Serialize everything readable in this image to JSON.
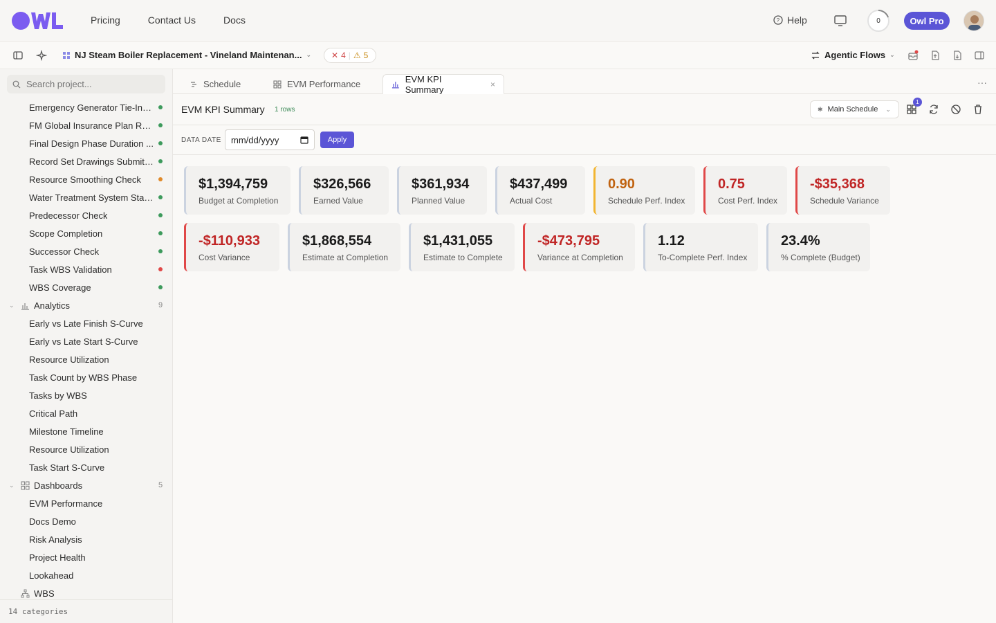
{
  "nav": {
    "links": [
      "Pricing",
      "Contact Us",
      "Docs"
    ],
    "help": "Help",
    "progress_count": "0",
    "pro_button": "Owl Pro"
  },
  "subbar": {
    "project_title": "NJ Steam Boiler Replacement - Vineland Maintenan...",
    "errors": "4",
    "warnings": "5",
    "agentic": "Agentic Flows"
  },
  "sidebar": {
    "search_placeholder": "Search project...",
    "items": [
      {
        "label": "Emergency Generator Tie-In f...",
        "status": "green"
      },
      {
        "label": "FM Global Insurance Plan Re...",
        "status": "green"
      },
      {
        "label": "Final Design Phase Duration ...",
        "status": "green"
      },
      {
        "label": "Record Set Drawings Submitt...",
        "status": "green"
      },
      {
        "label": "Resource Smoothing Check",
        "status": "orange"
      },
      {
        "label": "Water Treatment System Star...",
        "status": "green"
      },
      {
        "label": "Predecessor Check",
        "status": "green"
      },
      {
        "label": "Scope Completion",
        "status": "green"
      },
      {
        "label": "Successor Check",
        "status": "green"
      },
      {
        "label": "Task WBS Validation",
        "status": "red"
      },
      {
        "label": "WBS Coverage",
        "status": "green"
      }
    ],
    "analytics": {
      "label": "Analytics",
      "count": "9",
      "items": [
        "Early vs Late Finish S-Curve",
        "Early vs Late Start S-Curve",
        "Resource Utilization",
        "Task Count by WBS Phase",
        "Tasks by WBS",
        "Critical Path",
        "Milestone Timeline",
        "Resource Utilization",
        "Task Start S-Curve"
      ]
    },
    "dashboards": {
      "label": "Dashboards",
      "count": "5",
      "items": [
        "EVM Performance",
        "Docs Demo",
        "Risk Analysis",
        "Project Health",
        "Lookahead"
      ]
    },
    "wbs": {
      "label": "WBS"
    },
    "footer": "14 categories"
  },
  "tabs": [
    {
      "label": "Schedule",
      "icon": "schedule-icon"
    },
    {
      "label": "EVM Performance",
      "icon": "grid-icon"
    },
    {
      "label": "EVM KPI Summary",
      "icon": "bar-chart-icon"
    }
  ],
  "header": {
    "title": "EVM KPI Summary",
    "rows": "1 rows",
    "schedule_select": "Main Schedule",
    "notif_count": "1"
  },
  "datebar": {
    "label": "DATA DATE",
    "placeholder": "mm/dd/yyyy",
    "apply": "Apply"
  },
  "kpis_row1": [
    {
      "value": "$1,394,759",
      "caption": "Budget at Completion",
      "tone": "neutral"
    },
    {
      "value": "$326,566",
      "caption": "Earned Value",
      "tone": "neutral"
    },
    {
      "value": "$361,934",
      "caption": "Planned Value",
      "tone": "neutral"
    },
    {
      "value": "$437,499",
      "caption": "Actual Cost",
      "tone": "neutral"
    },
    {
      "value": "0.90",
      "caption": "Schedule Perf. Index",
      "tone": "warn"
    },
    {
      "value": "0.75",
      "caption": "Cost Perf. Index",
      "tone": "bad"
    },
    {
      "value": "-$35,368",
      "caption": "Schedule Variance",
      "tone": "bad"
    }
  ],
  "kpis_row2": [
    {
      "value": "-$110,933",
      "caption": "Cost Variance",
      "tone": "bad"
    },
    {
      "value": "$1,868,554",
      "caption": "Estimate at Completion",
      "tone": "neutral"
    },
    {
      "value": "$1,431,055",
      "caption": "Estimate to Complete",
      "tone": "neutral"
    },
    {
      "value": "-$473,795",
      "caption": "Variance at Completion",
      "tone": "bad"
    },
    {
      "value": "1.12",
      "caption": "To-Complete Perf. Index",
      "tone": "neutral"
    },
    {
      "value": "23.4%",
      "caption": "% Complete (Budget)",
      "tone": "neutral"
    }
  ],
  "colors": {
    "accent": "#5b55d6",
    "green": "#3d9a5c",
    "orange": "#e08a2a",
    "red": "#e04848"
  }
}
